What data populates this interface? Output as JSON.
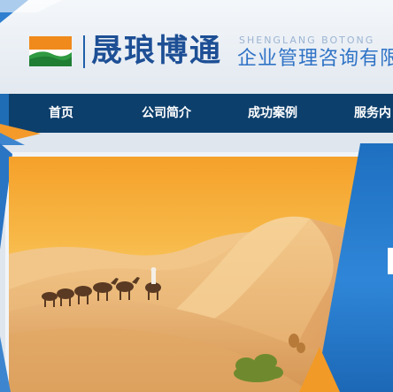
{
  "brand": {
    "name_cn": "晟琅博通",
    "name_en": "SHENGLANG BOTONG",
    "subtitle_cn": "企业管理咨询有限"
  },
  "nav": {
    "items": [
      {
        "label": "首页"
      },
      {
        "label": "公司简介"
      },
      {
        "label": "成功案例"
      },
      {
        "label": "服务内"
      }
    ]
  },
  "colors": {
    "nav_bg": "#0d3f6c",
    "brand_blue": "#1d4f95",
    "accent_orange": "#f49a2a",
    "accent_blue": "#2f86d8"
  },
  "banner": {
    "image": "desert-camel-caravan"
  }
}
